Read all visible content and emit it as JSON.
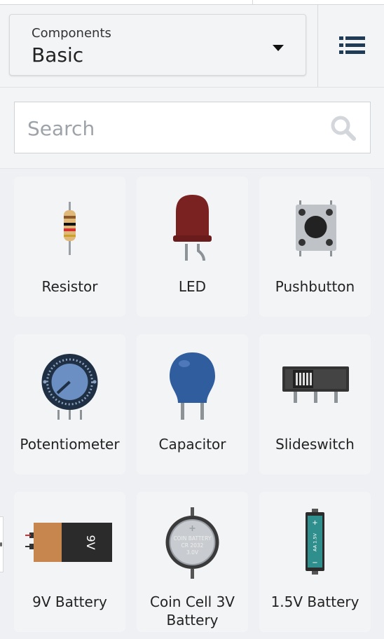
{
  "header": {
    "dropdown_label": "Components",
    "dropdown_value": "Basic",
    "caret_icon": "caret-down-icon",
    "list_view_icon": "list-view-icon"
  },
  "search": {
    "placeholder": "Search",
    "value": "",
    "icon": "search-icon"
  },
  "components": [
    {
      "name": "Resistor",
      "icon": "resistor-icon"
    },
    {
      "name": "LED",
      "icon": "led-icon"
    },
    {
      "name": "Pushbutton",
      "icon": "pushbutton-icon"
    },
    {
      "name": "Potentiometer",
      "icon": "potentiometer-icon"
    },
    {
      "name": "Capacitor",
      "icon": "capacitor-icon"
    },
    {
      "name": "Slideswitch",
      "icon": "slideswitch-icon"
    },
    {
      "name": "9V Battery",
      "icon": "battery-9v-icon",
      "art_text": "9V"
    },
    {
      "name": "Coin Cell 3V Battery",
      "icon": "coin-cell-battery-icon",
      "art_text": [
        "COIN BATTERY",
        "CR 2032",
        "3.0V"
      ]
    },
    {
      "name": "1.5V Battery",
      "icon": "battery-aa-icon",
      "art_text": "AA 1.5V"
    }
  ],
  "colors": {
    "panel_bg": "#eff0f3",
    "card_bg": "#f3f4f6",
    "led_red": "#7a2222",
    "capacitor_blue": "#2f5d9e",
    "aa_teal": "#2f8f8c",
    "battery_copper": "#c8864f"
  }
}
